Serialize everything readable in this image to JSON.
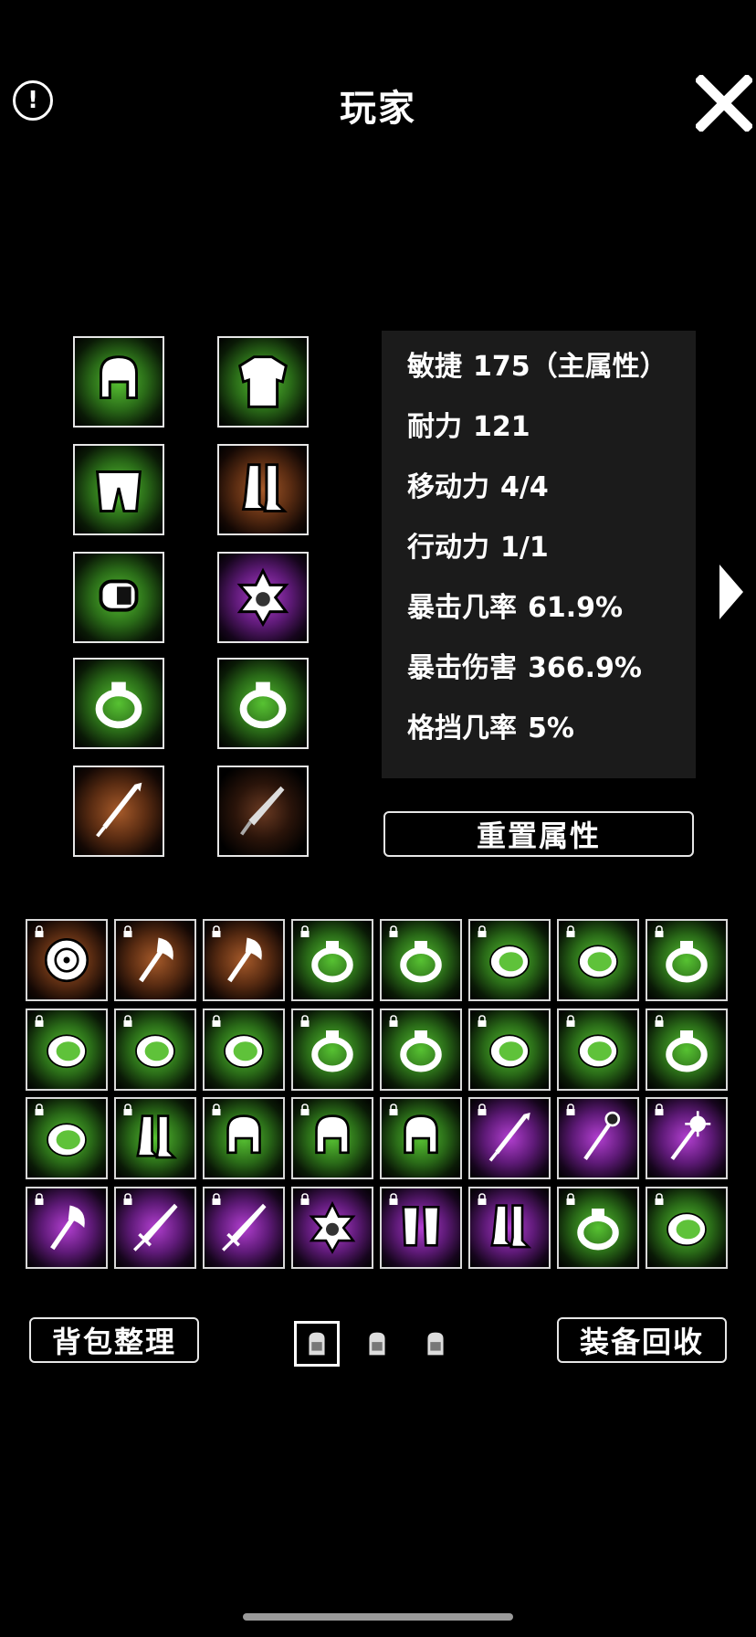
{
  "header": {
    "title": "玩家",
    "info_label": "!",
    "close_icon": "close-icon"
  },
  "colors": {
    "green": "#57c232",
    "orange": "#a65a2a",
    "purple": "#b23fd0",
    "panel": "#1b1b1b"
  },
  "equipment": {
    "slots": [
      {
        "name": "helmet",
        "rarity": "green",
        "icon": "helmet-icon"
      },
      {
        "name": "chest-armor",
        "rarity": "green",
        "icon": "chest-armor-icon"
      },
      {
        "name": "pants",
        "rarity": "green",
        "icon": "pants-icon"
      },
      {
        "name": "boots",
        "rarity": "orange",
        "icon": "boots-icon"
      },
      {
        "name": "bracer",
        "rarity": "green",
        "icon": "bracer-icon"
      },
      {
        "name": "amulet",
        "rarity": "purple",
        "icon": "amulet-icon"
      },
      {
        "name": "ring-left",
        "rarity": "green",
        "icon": "ring-icon"
      },
      {
        "name": "ring-right",
        "rarity": "green",
        "icon": "ring-icon"
      },
      {
        "name": "main-weapon",
        "rarity": "orange",
        "icon": "spear-icon"
      },
      {
        "name": "off-weapon",
        "rarity": "dark",
        "icon": "dagger-icon"
      }
    ]
  },
  "stats": {
    "rows": [
      {
        "label": "敏捷",
        "value": "175（主属性）"
      },
      {
        "label": "耐力",
        "value": "121"
      },
      {
        "label": "移动力",
        "value": "4/4"
      },
      {
        "label": "行动力",
        "value": "1/1"
      },
      {
        "label": "暴击几率",
        "value": "61.9%"
      },
      {
        "label": "暴击伤害",
        "value": "366.9%"
      },
      {
        "label": "格挡几率",
        "value": "5%"
      }
    ],
    "reset_label": "重置属性"
  },
  "inventory": {
    "rows": [
      [
        "shield-orange",
        "axe-orange",
        "axe-orange",
        "ring-green",
        "ring-green",
        "ring-gem-green",
        "ring-gem-green",
        "ring-green"
      ],
      [
        "ring-gem-green",
        "ring-gem-green",
        "ring-gem-green",
        "ring-green",
        "ring-green",
        "ring-gem-green",
        "ring-gem-green",
        "ring-green"
      ],
      [
        "ring-gem-green",
        "boots-green",
        "helmet-green",
        "helmet-green",
        "helmet-green",
        "spear-purple",
        "staff-purple",
        "mace-purple"
      ],
      [
        "axe-purple",
        "sword-purple",
        "sword-purple",
        "amulet-purple",
        "legguards-purple",
        "boots-purple",
        "ring-green",
        "ring-gem-green"
      ]
    ]
  },
  "footer": {
    "sort_label": "背包整理",
    "recycle_label": "装备回收",
    "bag_tabs": [
      "bag-1",
      "bag-2",
      "bag-3"
    ],
    "active_tab": 0
  }
}
